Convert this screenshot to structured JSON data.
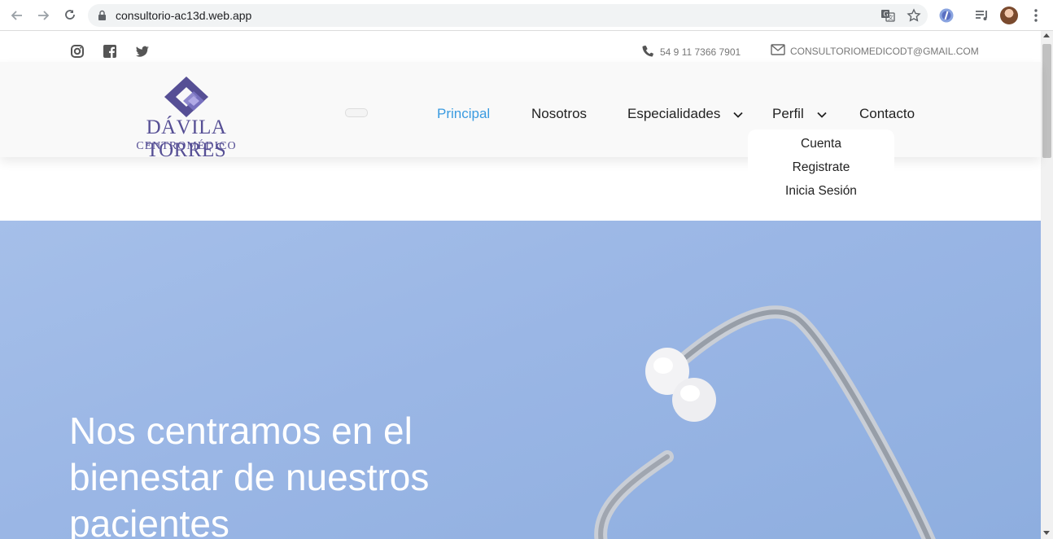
{
  "browser": {
    "url": "consultorio-ac13d.web.app",
    "icons": [
      "back-icon",
      "forward-icon",
      "reload-icon",
      "lock-icon",
      "translate-icon",
      "star-icon",
      "extension-icon",
      "media-icon",
      "avatar",
      "menu-icon"
    ]
  },
  "topbar": {
    "social": [
      "instagram-icon",
      "facebook-icon",
      "twitter-icon"
    ],
    "phone": "54 9 11 7366 7901",
    "email": "CONSULTORIOMEDICODT@GMAIL.COM"
  },
  "brand": {
    "name": "DÁVILA TORRES",
    "subtitle": "CENTROMÉDICO",
    "colors": {
      "primary": "#564f95",
      "secondary": "#7b74c6"
    }
  },
  "nav": {
    "items": [
      {
        "label": "Principal",
        "active": true
      },
      {
        "label": "Nosotros"
      },
      {
        "label": "Especialidades",
        "dropdown": true
      },
      {
        "label": "Perfil",
        "dropdown": true
      },
      {
        "label": "Contacto"
      }
    ],
    "active_color": "#3a9be0"
  },
  "perfil_menu": {
    "items": [
      "Cuenta",
      "Registrate",
      "Inicia Sesión"
    ]
  },
  "hero": {
    "heading": "Nos centramos en el bienestar de nuestros pacientes",
    "background": "#9ab6e5"
  }
}
